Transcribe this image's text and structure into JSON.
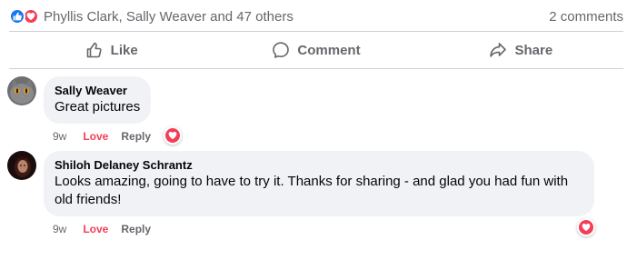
{
  "summary": {
    "names": "Phyllis Clark, Sally Weaver and 47 others",
    "comments": "2 comments",
    "like_color": "#1877f2",
    "love_color": "#f33e58"
  },
  "actions": {
    "like": "Like",
    "comment": "Comment",
    "share": "Share"
  },
  "comments": [
    {
      "author": "Sally Weaver",
      "text": "Great pictures",
      "time": "9w",
      "reaction_label": "Love",
      "reply_label": "Reply",
      "reaction_icon": "heart-icon"
    },
    {
      "author": "Shiloh Delaney Schrantz",
      "text": "Looks amazing, going to have to try it. Thanks for sharing - and glad you had fun with old friends!",
      "time": "9w",
      "reaction_label": "Love",
      "reply_label": "Reply",
      "reaction_icon": "heart-icon"
    }
  ]
}
